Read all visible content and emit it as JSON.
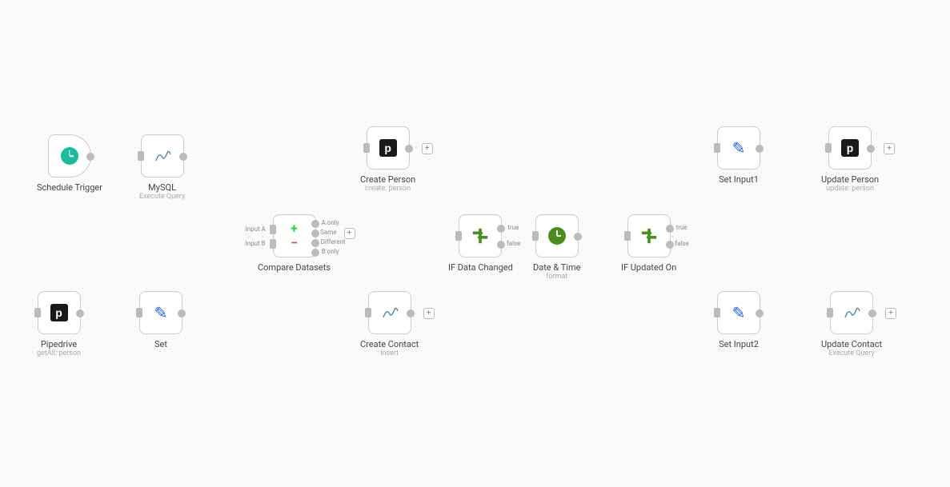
{
  "nodes": {
    "schedule": {
      "label": "Schedule Trigger",
      "sub": ""
    },
    "mysql": {
      "label": "MySQL",
      "sub": "Execute Query"
    },
    "pipedrive": {
      "label": "Pipedrive",
      "sub": "getAll: person"
    },
    "set": {
      "label": "Set",
      "sub": ""
    },
    "compare": {
      "label": "Compare Datasets",
      "sub": ""
    },
    "createPerson": {
      "label": "Create Person",
      "sub": "create: person"
    },
    "createContact": {
      "label": "Create Contact",
      "sub": "Insert"
    },
    "ifData": {
      "label": "IF Data Changed",
      "sub": ""
    },
    "dateTime": {
      "label": "Date & Time",
      "sub": "format"
    },
    "ifUpdated": {
      "label": "IF Updated On",
      "sub": ""
    },
    "setInput1": {
      "label": "Set Input1",
      "sub": ""
    },
    "setInput2": {
      "label": "Set Input2",
      "sub": ""
    },
    "updatePerson": {
      "label": "Update Person",
      "sub": "update: person"
    },
    "updateContact": {
      "label": "Update Contact",
      "sub": "Execute Query"
    }
  },
  "ports": {
    "inputA": "Input A",
    "inputB": "Input B",
    "aOnly": "A only",
    "same": "Same",
    "diff": "Different",
    "bOnly": "B only",
    "true": "true",
    "false": "false"
  }
}
